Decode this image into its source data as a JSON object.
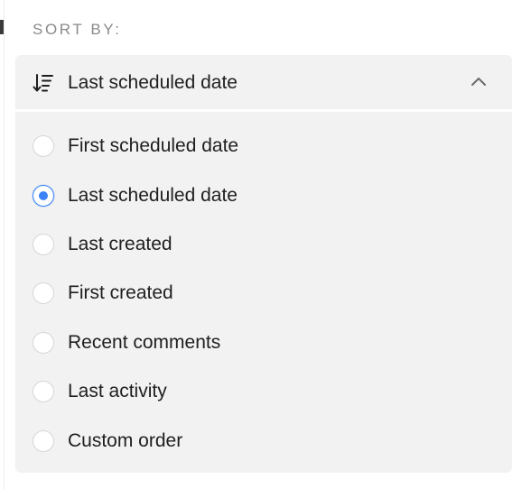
{
  "section": {
    "title": "SORT BY:"
  },
  "dropdown": {
    "selected_label": "Last scheduled date",
    "expanded": true,
    "options": [
      {
        "label": "First scheduled date",
        "selected": false
      },
      {
        "label": "Last scheduled date",
        "selected": true
      },
      {
        "label": "Last created",
        "selected": false
      },
      {
        "label": "First created",
        "selected": false
      },
      {
        "label": "Recent comments",
        "selected": false
      },
      {
        "label": "Last activity",
        "selected": false
      },
      {
        "label": "Custom order",
        "selected": false
      }
    ]
  },
  "icons": {
    "sort": "sort-descending-icon",
    "chevron": "chevron-up-icon"
  },
  "colors": {
    "accent": "#3b82f6",
    "panel_bg": "#f2f2f2",
    "label_muted": "#8a8a8a",
    "text": "#1f1f1f"
  }
}
